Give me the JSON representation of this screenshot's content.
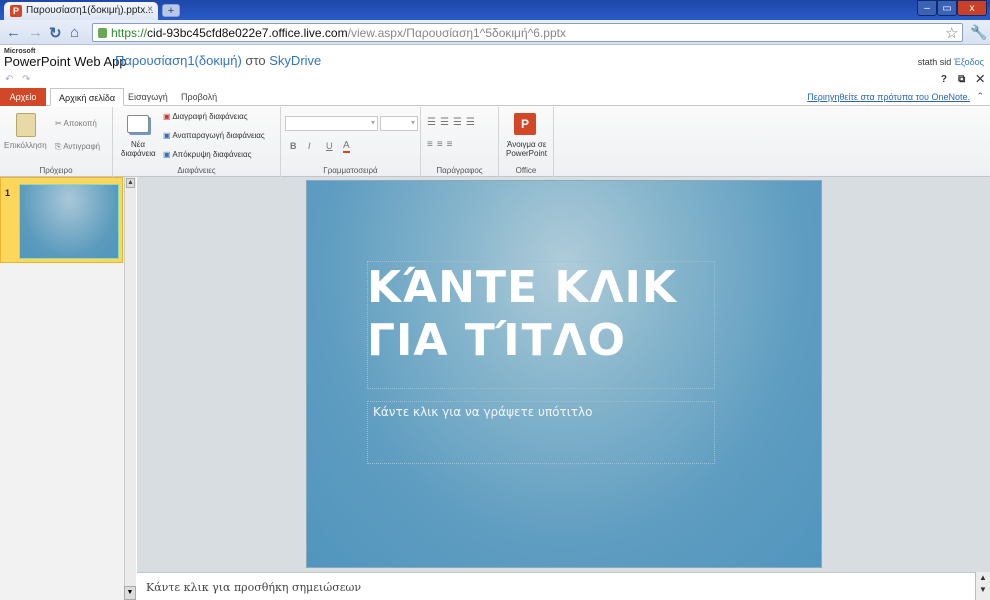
{
  "browser": {
    "tab_title": "Παρουσίαση1(δοκιμή).pptx...",
    "tab_close": "×",
    "new_tab": "+",
    "url_proto": "https://",
    "url_host": "cid-93bc45cfd8e022e7.office.live.com",
    "url_path": "/view.aspx/Παρουσίαση1^5δοκιμή^6.pptx",
    "win_minimize": "–",
    "win_restore": "▭",
    "win_close": "x"
  },
  "app": {
    "ms_label": "Microsoft",
    "app_name": "PowerPoint Web App",
    "doc_name": "Παρουσίαση1(δοκιμή)",
    "doc_location_prefix": "στο",
    "doc_location": "SkyDrive",
    "user_name": "stath sid",
    "sign_out": "Έξοδος"
  },
  "ribbon_tabs": [
    "Αρχείο",
    "Αρχική σελίδα",
    "Εισαγωγή",
    "Προβολή"
  ],
  "onenote_link": "Περιηγηθείτε στα πρότυπα του OneNote.",
  "ribbon": {
    "clipboard": {
      "paste": "Επικόλληση",
      "cut": "Αποκοπή",
      "copy": "Αντιγραφή",
      "label": "Πρόχειρο"
    },
    "slides": {
      "new_line1": "Νέα",
      "new_line2": "διαφάνεια",
      "delete": "Διαγραφή διαφάνειας",
      "duplicate": "Αναπαραγωγή διαφάνειας",
      "hide": "Απόκρυψη διαφάνειας",
      "label": "Διαφάνειες"
    },
    "font": {
      "bold": "B",
      "italic": "I",
      "underline": "U",
      "color": "A",
      "label": "Γραμματοσειρά"
    },
    "paragraph": {
      "label": "Παράγραφος"
    },
    "office": {
      "open_line1": "Άνοιγμα σε",
      "open_line2": "PowerPoint",
      "label": "Office"
    }
  },
  "slides_panel": {
    "number": "1"
  },
  "slide": {
    "title_line1": "ΚΆΝΤΕ ΚΛΙΚ",
    "title_line2": "ΓΙΑ ΤΊΤΛΟ",
    "subtitle": "Κάντε κλικ για να γράψετε υπότιτλο"
  },
  "notes": {
    "placeholder": "Κάντε κλικ για προσθήκη σημειώσεων"
  },
  "colors": {
    "accent": "#d24726",
    "slide_bg": "#5f9dc1",
    "link": "#3274c1",
    "selected_thumb": "#fcd75b"
  }
}
